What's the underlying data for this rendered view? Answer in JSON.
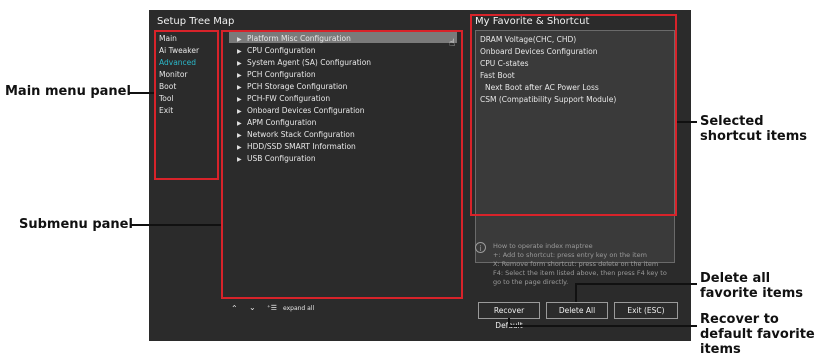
{
  "tree": {
    "title": "Setup Tree Map",
    "main_menu": [
      "Main",
      "Ai Tweaker",
      "Advanced",
      "Monitor",
      "Boot",
      "Tool",
      "Exit"
    ],
    "active_menu": "Advanced",
    "submenu": [
      "Platform Misc Configuration",
      "CPU Configuration",
      "System Agent (SA) Configuration",
      "PCH Configuration",
      "PCH Storage Configuration",
      "PCH-FW Configuration",
      "Onboard Devices Configuration",
      "APM Configuration",
      "Network Stack Configuration",
      "HDD/SSD SMART Information",
      "USB Configuration"
    ],
    "expand_all_label": "expand all"
  },
  "favorites": {
    "title": "My Favorite & Shortcut",
    "items": [
      "DRAM Voltage(CHC, CHD)",
      "Onboard Devices Configuration",
      "CPU C-states",
      "Fast Boot",
      "Next Boot after AC Power Loss",
      "CSM (Compatibility Support Module)"
    ],
    "info_lines": [
      "How to operate index maptree",
      "+: Add to shortcut: press entry key on the item",
      "X: Remove form shortcut: press delete on the item",
      "F4: Select the item listed above, then press F4 key to",
      "go to the page directly."
    ],
    "buttons": {
      "recover": "Recover Default",
      "delete": "Delete All",
      "exit": "Exit (ESC)"
    }
  },
  "callouts": {
    "main_menu_panel": "Main menu panel",
    "submenu_panel": "Submenu panel",
    "selected_shortcut": "Selected shortcut items",
    "delete_all": "Delete all favorite items",
    "recover_default": "Recover to default favorite items"
  },
  "colors": {
    "accent_red": "#d8232a",
    "active_menu": "#2bb8c9",
    "screen_bg": "#2b2b2b"
  }
}
